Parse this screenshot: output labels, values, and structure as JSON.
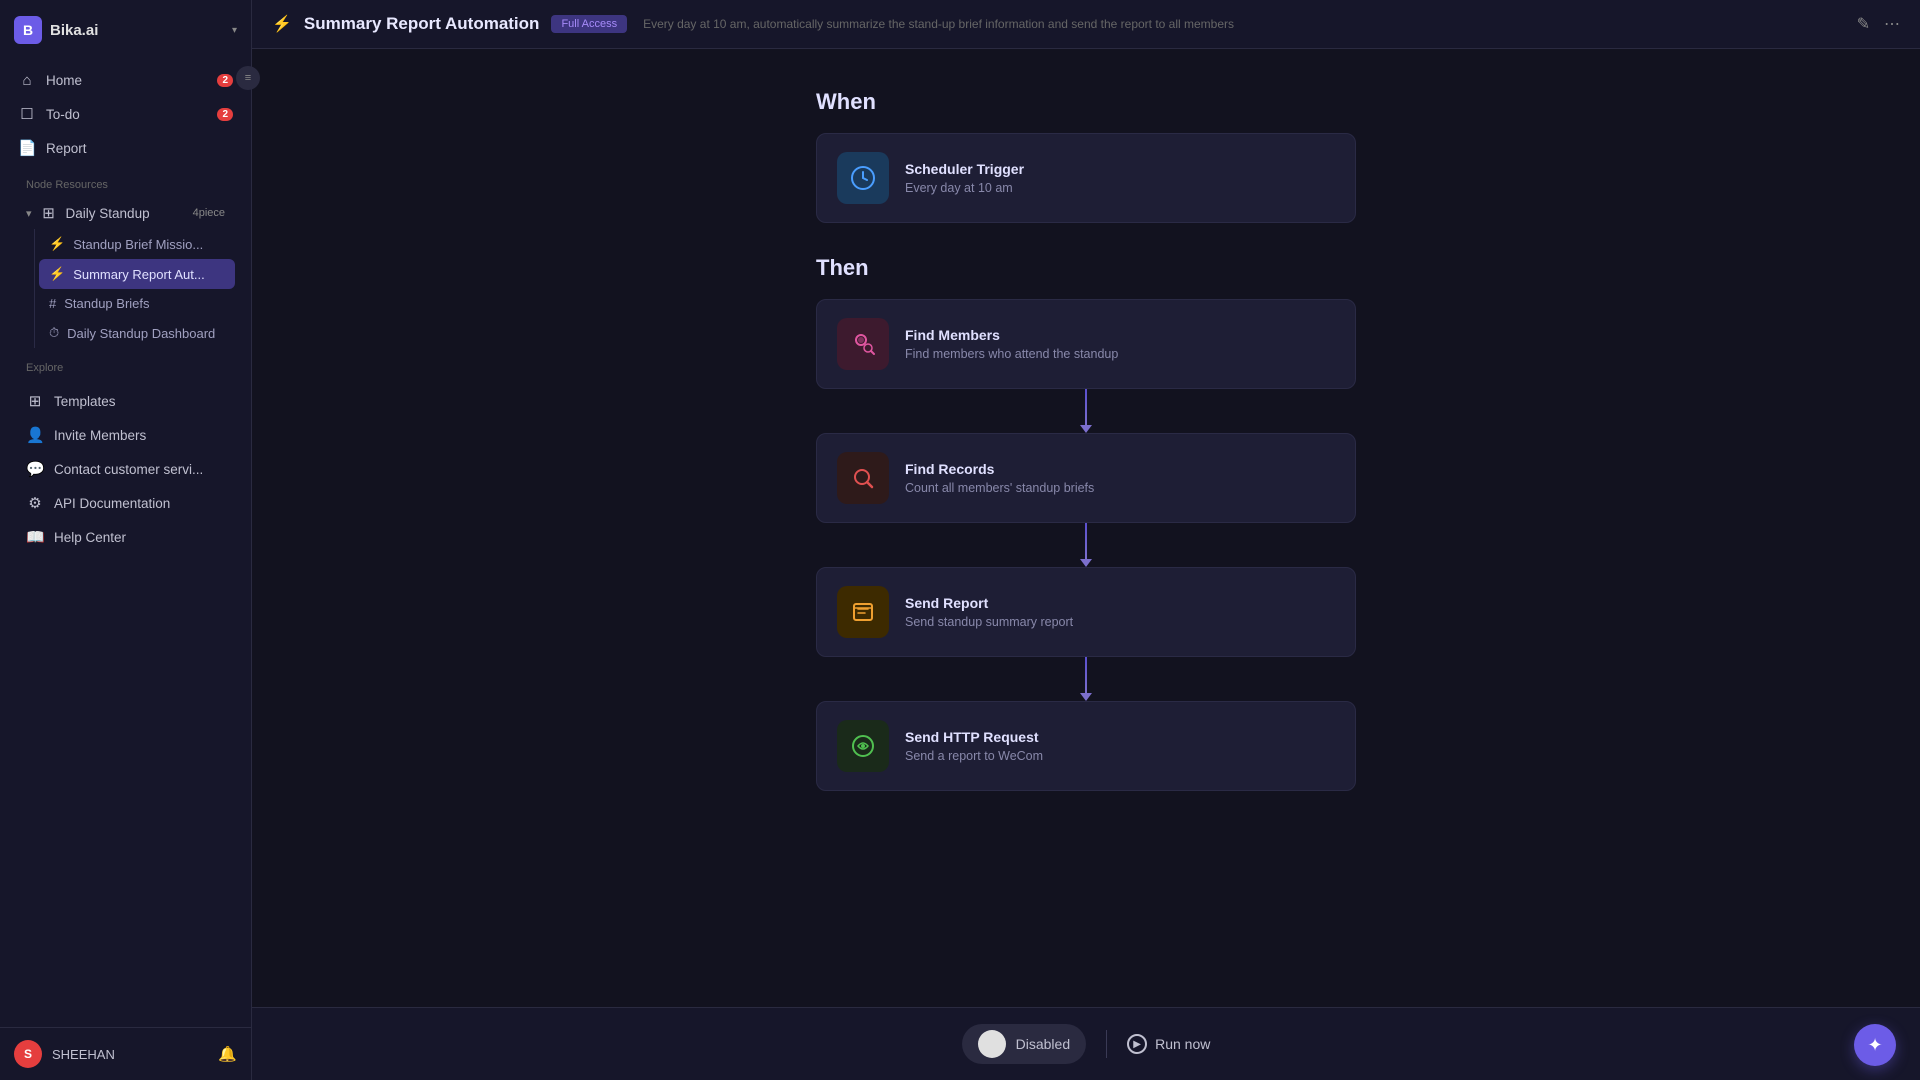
{
  "app": {
    "logo": "B",
    "name": "Bika.ai",
    "chevron": "▾"
  },
  "topbar": {
    "lightning": "⚡",
    "title": "Summary Report Automation",
    "badge": "Full Access",
    "description": "Every day at 10 am, automatically summarize the stand-up brief information and send the report to all members",
    "edit_icon": "✎",
    "more_icon": "⋯"
  },
  "sidebar": {
    "nav_items": [
      {
        "id": "home",
        "icon": "⌂",
        "label": "Home",
        "badge": "2"
      },
      {
        "id": "todo",
        "icon": "☐",
        "label": "To-do",
        "badge": "2"
      },
      {
        "id": "report",
        "icon": "📄",
        "label": "Report",
        "badge": null
      }
    ],
    "node_resources_label": "Node Resources",
    "daily_standup": {
      "label": "Daily Standup",
      "count": "4piece",
      "children": [
        {
          "id": "standup-brief",
          "icon": "⚡",
          "label": "Standup Brief Missio..."
        },
        {
          "id": "summary-report",
          "icon": "⚡",
          "label": "Summary Report Aut...",
          "active": true
        },
        {
          "id": "standup-briefs",
          "icon": "#",
          "label": "Standup Briefs"
        },
        {
          "id": "daily-dashboard",
          "icon": "⏱",
          "label": "Daily Standup Dashboard"
        }
      ]
    },
    "explore_label": "Explore",
    "explore_items": [
      {
        "id": "templates",
        "icon": "⊞",
        "label": "Templates"
      },
      {
        "id": "invite-members",
        "icon": "👤",
        "label": "Invite Members"
      },
      {
        "id": "contact-support",
        "icon": "💬",
        "label": "Contact customer servi..."
      },
      {
        "id": "api-docs",
        "icon": "⚙",
        "label": "API Documentation"
      },
      {
        "id": "help-center",
        "icon": "📖",
        "label": "Help Center"
      }
    ],
    "user": {
      "avatar": "S",
      "name": "SHEEHAN",
      "bell": "🔔"
    }
  },
  "canvas": {
    "when_label": "When",
    "then_label": "Then",
    "trigger": {
      "title": "Scheduler Trigger",
      "description": "Every day at 10 am"
    },
    "actions": [
      {
        "id": "find-members",
        "title": "Find Members",
        "description": "Find members who attend the standup",
        "icon_type": "find-members"
      },
      {
        "id": "find-records",
        "title": "Find Records",
        "description": "Count all members' standup briefs",
        "icon_type": "find-records"
      },
      {
        "id": "send-report",
        "title": "Send Report",
        "description": "Send standup summary report",
        "icon_type": "send-report"
      },
      {
        "id": "http-request",
        "title": "Send HTTP Request",
        "description": "Send a report to WeCom",
        "icon_type": "http-request"
      }
    ]
  },
  "bottom_bar": {
    "toggle_label": "Disabled",
    "run_now_label": "Run now",
    "fab_icon": "✦"
  }
}
